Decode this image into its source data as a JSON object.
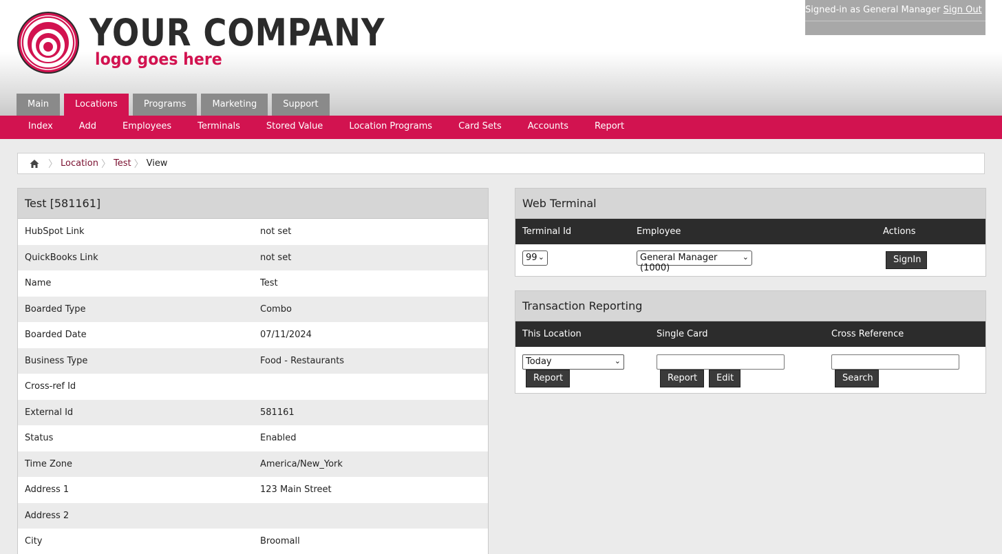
{
  "logo": {
    "main": "YOUR COMPANY",
    "sub": "logo goes here"
  },
  "session": {
    "signed_in_text": "Signed-in as General Manager",
    "sign_out_label": "Sign Out"
  },
  "main_tabs": [
    "Main",
    "Locations",
    "Programs",
    "Marketing",
    "Support"
  ],
  "sub_nav": [
    "Index",
    "Add",
    "Employees",
    "Terminals",
    "Stored Value",
    "Location Programs",
    "Card Sets",
    "Accounts",
    "Report"
  ],
  "breadcrumb": {
    "items": [
      "Location",
      "Test"
    ],
    "current": "View"
  },
  "location": {
    "title": "Test [581161]",
    "rows": [
      {
        "label": "HubSpot Link",
        "value": "not set"
      },
      {
        "label": "QuickBooks Link",
        "value": "not set"
      },
      {
        "label": "Name",
        "value": "Test"
      },
      {
        "label": "Boarded Type",
        "value": "Combo"
      },
      {
        "label": "Boarded Date",
        "value": "07/11/2024"
      },
      {
        "label": "Business Type",
        "value": "Food - Restaurants"
      },
      {
        "label": "Cross-ref Id",
        "value": ""
      },
      {
        "label": "External Id",
        "value": "581161"
      },
      {
        "label": "Status",
        "value": "Enabled"
      },
      {
        "label": "Time Zone",
        "value": "America/New_York"
      },
      {
        "label": "Address 1",
        "value": "123 Main Street"
      },
      {
        "label": "Address 2",
        "value": ""
      },
      {
        "label": "City",
        "value": "Broomall"
      }
    ]
  },
  "web_terminal": {
    "title": "Web Terminal",
    "col_terminal": "Terminal Id",
    "col_employee": "Employee",
    "col_actions": "Actions",
    "terminal_value": "99",
    "employee_value": "General Manager (1000)",
    "signin_label": "SignIn"
  },
  "transaction_reporting": {
    "title": "Transaction Reporting",
    "col_location": "This Location",
    "col_card": "Single Card",
    "col_xref": "Cross Reference",
    "period_value": "Today",
    "report_label": "Report",
    "edit_label": "Edit",
    "search_label": "Search"
  },
  "colors": {
    "brand": "#d21350",
    "tab_inactive": "#8a8a8a",
    "dark": "#2c2c2c"
  }
}
